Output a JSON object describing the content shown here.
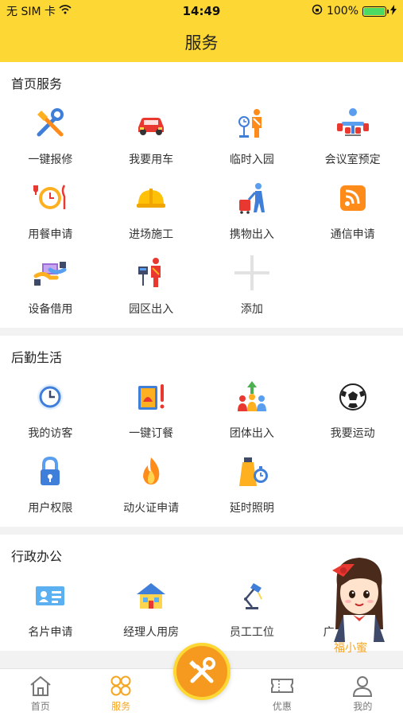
{
  "status": {
    "carrier": "无 SIM 卡",
    "time": "14:49",
    "battery": "100%"
  },
  "header": {
    "title": "服务"
  },
  "sections": [
    {
      "title": "首页服务",
      "items": [
        {
          "label": "一键报修",
          "icon": "tools-icon"
        },
        {
          "label": "我要用车",
          "icon": "car-icon"
        },
        {
          "label": "临时入园",
          "icon": "visitor-entry-icon"
        },
        {
          "label": "会议室预定",
          "icon": "meeting-room-icon"
        },
        {
          "label": "用餐申请",
          "icon": "dining-icon"
        },
        {
          "label": "进场施工",
          "icon": "helmet-icon"
        },
        {
          "label": "携物出入",
          "icon": "luggage-icon"
        },
        {
          "label": "通信申请",
          "icon": "signal-icon"
        },
        {
          "label": "设备借用",
          "icon": "device-borrow-icon"
        },
        {
          "label": "园区出入",
          "icon": "park-access-icon"
        },
        {
          "label": "添加",
          "icon": "plus-icon"
        }
      ]
    },
    {
      "title": "后勤生活",
      "items": [
        {
          "label": "我的访客",
          "icon": "clock-icon"
        },
        {
          "label": "一键订餐",
          "icon": "order-meal-icon"
        },
        {
          "label": "团体出入",
          "icon": "group-icon"
        },
        {
          "label": "我要运动",
          "icon": "football-icon"
        },
        {
          "label": "用户权限",
          "icon": "lock-icon"
        },
        {
          "label": "动火证申请",
          "icon": "fire-icon"
        },
        {
          "label": "延时照明",
          "icon": "lighting-icon"
        }
      ]
    },
    {
      "title": "行政办公",
      "items": [
        {
          "label": "名片申请",
          "icon": "business-card-icon"
        },
        {
          "label": "经理人用房",
          "icon": "house-icon"
        },
        {
          "label": "员工工位",
          "icon": "desk-lamp-icon"
        },
        {
          "label": "广",
          "icon": "generic-icon"
        }
      ]
    }
  ],
  "mascot": {
    "label": "福小蜜"
  },
  "tabs": [
    {
      "label": "首页",
      "icon": "home-icon"
    },
    {
      "label": "服务",
      "icon": "service-icon"
    },
    {
      "label": "",
      "icon": "wrench-icon"
    },
    {
      "label": "优惠",
      "icon": "ticket-icon"
    },
    {
      "label": "我的",
      "icon": "user-icon"
    }
  ],
  "colors": {
    "brand": "#fdd835",
    "accent": "#f5a623"
  }
}
